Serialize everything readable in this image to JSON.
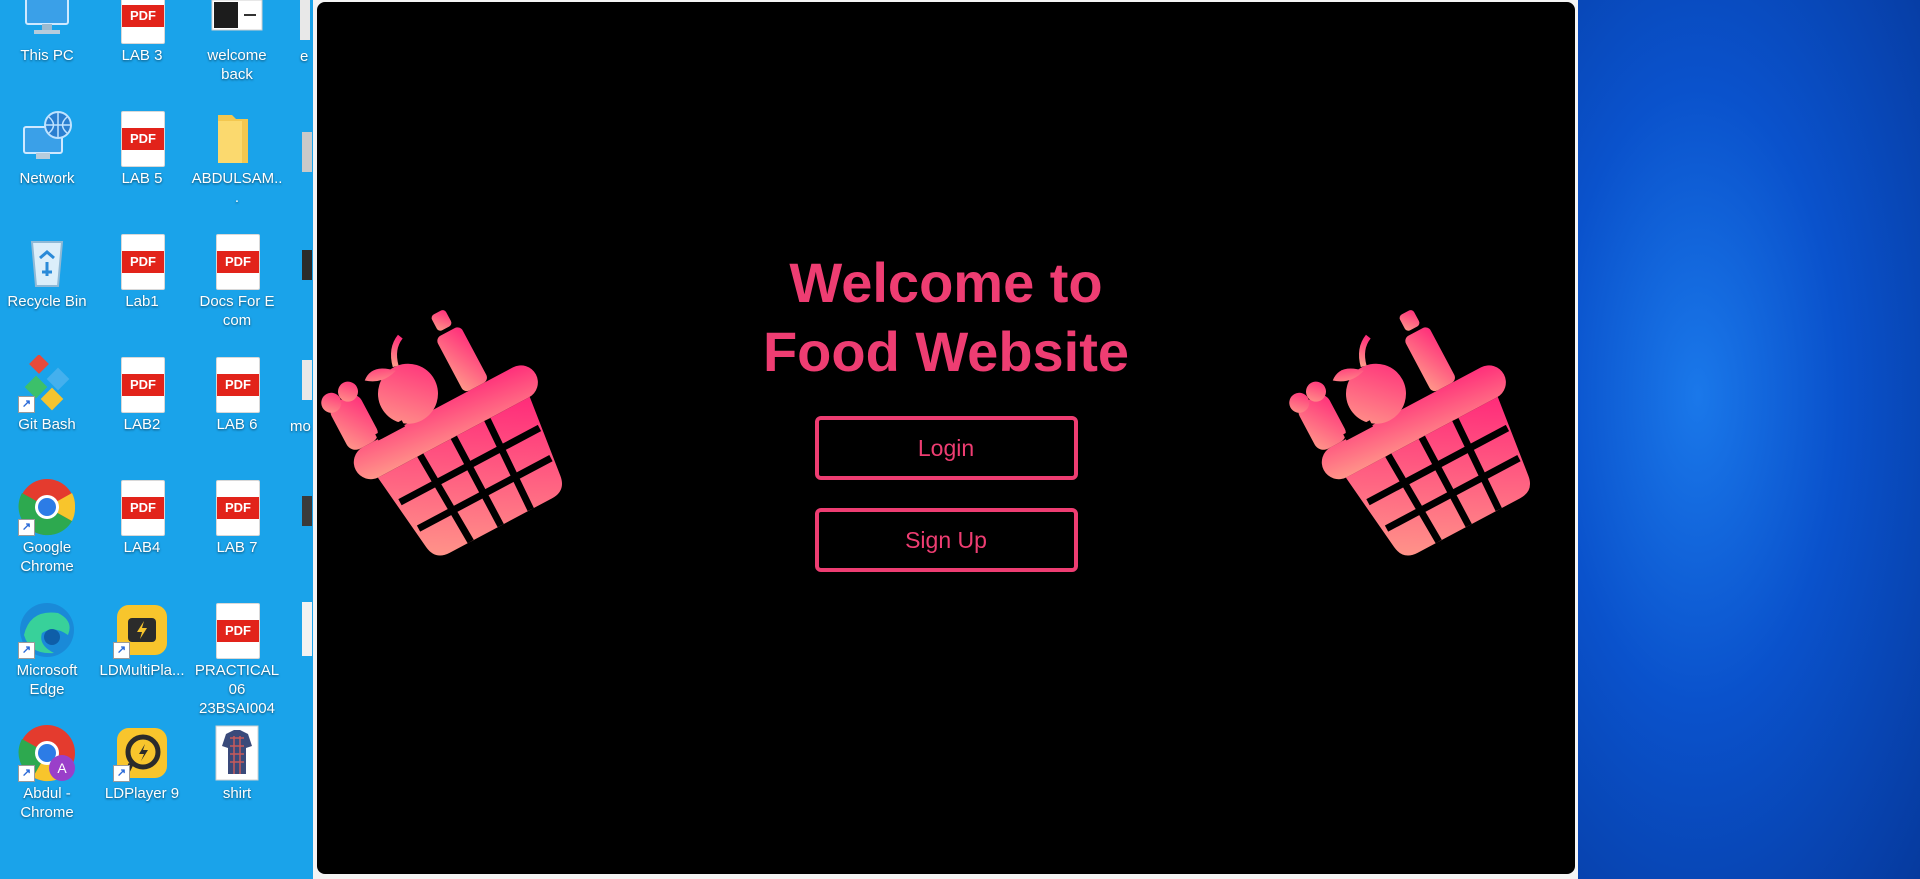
{
  "desktop": {
    "icons": [
      {
        "label": "This PC",
        "icon": "this-pc-icon"
      },
      {
        "label": "LAB 3",
        "icon": "pdf-file-icon"
      },
      {
        "label": "welcome back",
        "icon": "image-file-icon"
      },
      {
        "label": "Network",
        "icon": "network-icon"
      },
      {
        "label": "LAB 5",
        "icon": "pdf-file-icon"
      },
      {
        "label": "ABDULSAM...",
        "icon": "folder-icon"
      },
      {
        "label": "Recycle Bin",
        "icon": "recycle-bin-icon"
      },
      {
        "label": "Lab1",
        "icon": "pdf-file-icon"
      },
      {
        "label": "Docs For E com",
        "icon": "pdf-file-icon"
      },
      {
        "label": "Git Bash",
        "icon": "git-bash-icon"
      },
      {
        "label": "LAB2",
        "icon": "pdf-file-icon"
      },
      {
        "label": "LAB 6",
        "icon": "pdf-file-icon"
      },
      {
        "label": "Google Chrome",
        "icon": "chrome-icon"
      },
      {
        "label": "LAB4",
        "icon": "pdf-file-icon"
      },
      {
        "label": "LAB 7",
        "icon": "pdf-file-icon"
      },
      {
        "label": "Microsoft Edge",
        "icon": "edge-icon"
      },
      {
        "label": "LDMultiPla...",
        "icon": "ldmultiplayer-icon"
      },
      {
        "label": "PRACTICAL 06 23BSAI004",
        "icon": "pdf-file-icon"
      },
      {
        "label": "Abdul - Chrome",
        "icon": "chrome-profile-icon"
      },
      {
        "label": "LDPlayer 9",
        "icon": "ldplayer-icon"
      },
      {
        "label": "shirt",
        "icon": "shirt-image-icon"
      }
    ],
    "partial_labels": [
      "e",
      "mo"
    ],
    "pdf_badge": "PDF",
    "profile_initial": "A"
  },
  "app": {
    "title": "Welcome to Food Website",
    "login_label": "Login",
    "signup_label": "Sign Up",
    "accent_color": "#ee3d72",
    "background_color": "#000000",
    "decoration_icon": "shopping-basket-icon"
  }
}
